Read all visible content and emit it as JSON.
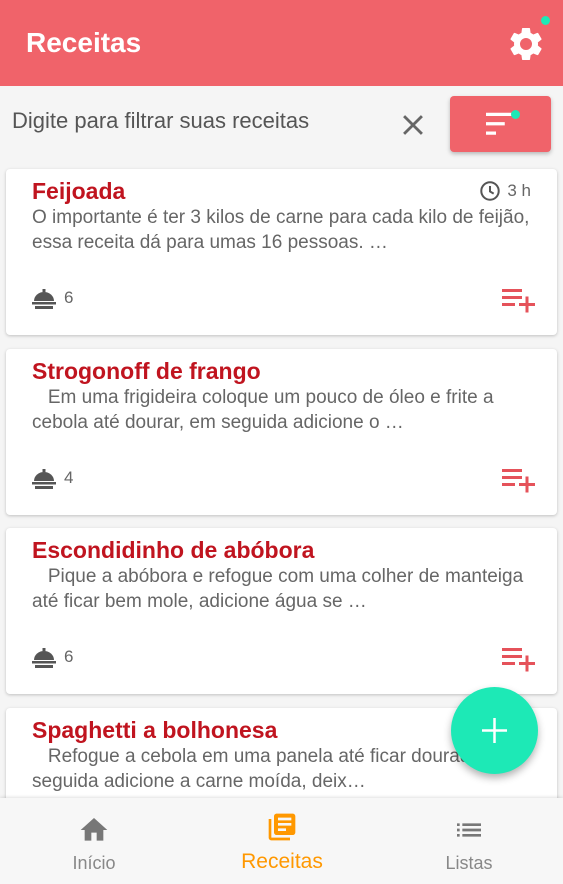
{
  "appbar": {
    "title": "Receitas"
  },
  "filter": {
    "placeholder": "Digite para filtrar suas receitas",
    "value": ""
  },
  "recipes": [
    {
      "title": "Feijoada",
      "time": "3 h",
      "description": "O importante é ter 3 kilos de carne para cada kilo de feijão, essa receita dá para umas 16 pessoas. …",
      "servings": "6"
    },
    {
      "title": "Strogonoff de frango",
      "time": "",
      "description": "   Em uma frigideira coloque um pouco de óleo e frite a cebola até dourar, em seguida adicione o …",
      "servings": "4"
    },
    {
      "title": "Escondidinho de abóbora",
      "time": "",
      "description": "   Pique a abóbora e refogue com uma colher de manteiga até ficar bem mole, adicione água se …",
      "servings": "6"
    },
    {
      "title": "Spaghetti a bolhonesa",
      "time": "",
      "description": "   Refogue a cebola em uma panela até ficar dourada, em seguida adicione a carne moída, deix…",
      "servings": ""
    }
  ],
  "bottom_nav": [
    {
      "label": "Início",
      "icon": "home-icon"
    },
    {
      "label": "Receitas",
      "icon": "book-icon",
      "active": true
    },
    {
      "label": "Listas",
      "icon": "list-icon"
    }
  ],
  "colors": {
    "primary": "#f0636a",
    "accent": "#1de9b6",
    "title": "#c0141f",
    "active_nav": "#ff9800"
  }
}
